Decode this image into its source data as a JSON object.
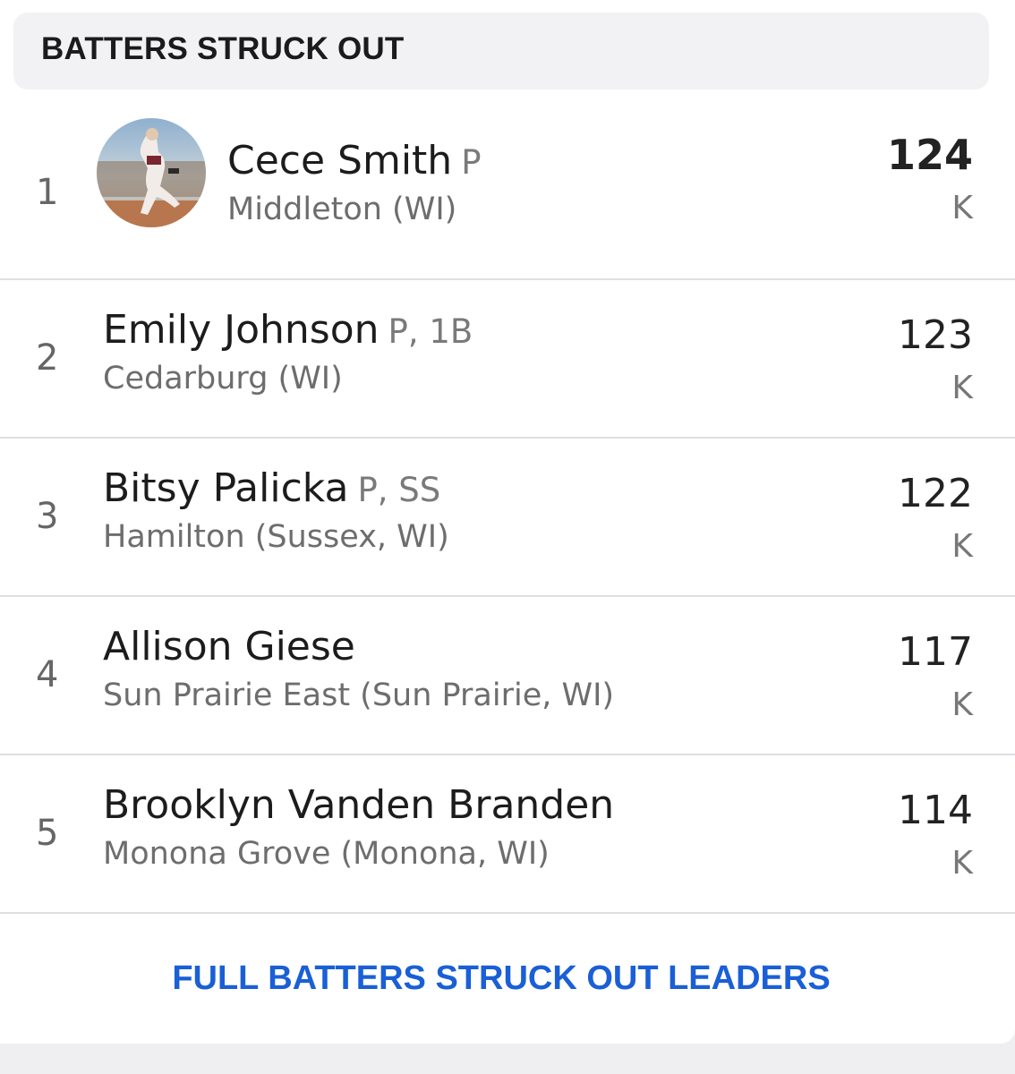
{
  "header": {
    "title": "BATTERS STRUCK OUT"
  },
  "rows": [
    {
      "rank": "1",
      "name": "Cece Smith",
      "position": "P",
      "school": "Middleton (WI)",
      "value": "124",
      "unit": "K",
      "avatar": "player-photo"
    },
    {
      "rank": "2",
      "name": "Emily Johnson",
      "position": "P, 1B",
      "school": "Cedarburg (WI)",
      "value": "123",
      "unit": "K"
    },
    {
      "rank": "3",
      "name": "Bitsy Palicka",
      "position": "P, SS",
      "school": "Hamilton (Sussex, WI)",
      "value": "122",
      "unit": "K"
    },
    {
      "rank": "4",
      "name": "Allison Giese",
      "position": "",
      "school": "Sun Prairie East (Sun Prairie, WI)",
      "value": "117",
      "unit": "K"
    },
    {
      "rank": "5",
      "name": "Brooklyn Vanden Branden",
      "position": "",
      "school": "Monona Grove (Monona, WI)",
      "value": "114",
      "unit": "K"
    }
  ],
  "footer": {
    "link_label": "FULL BATTERS STRUCK OUT LEADERS"
  },
  "colors": {
    "link": "#1a5fd6",
    "header_bg": "#f2f2f4",
    "divider": "#dedee3"
  }
}
